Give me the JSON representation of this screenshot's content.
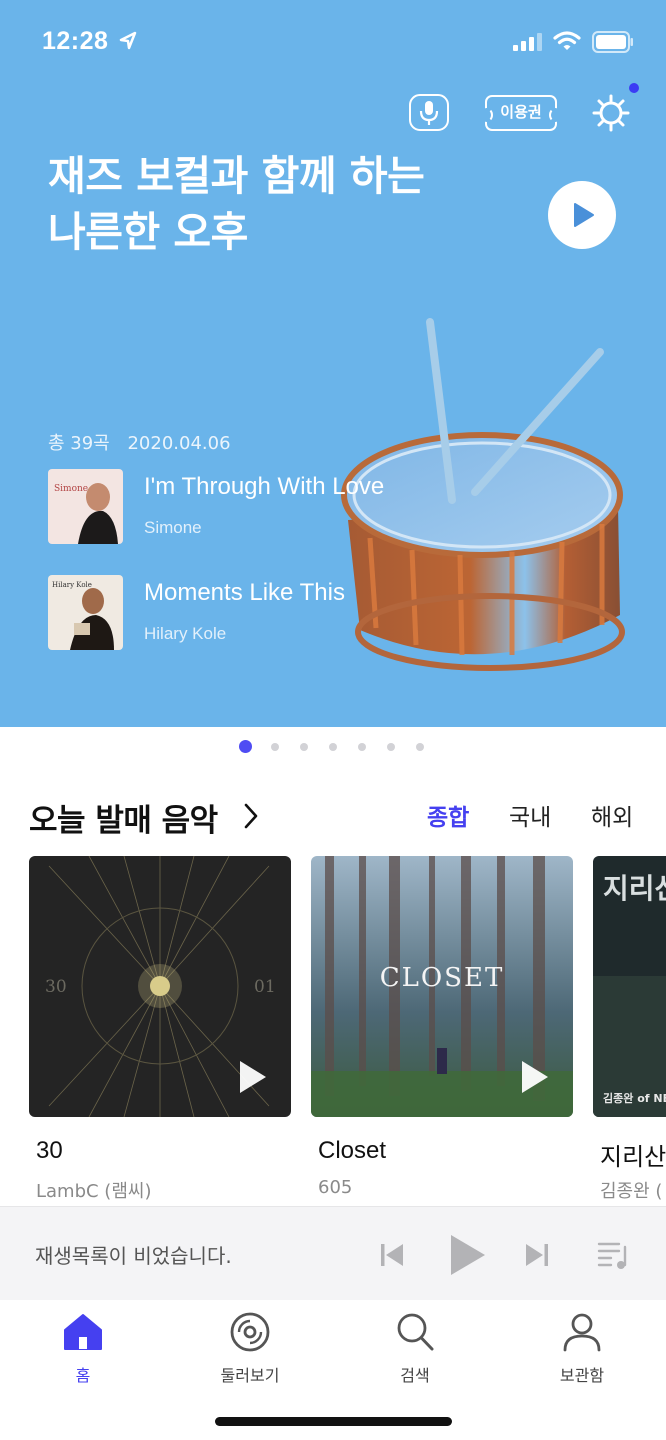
{
  "status_bar": {
    "time": "12:28"
  },
  "header": {
    "pass_label": "이용권"
  },
  "hero": {
    "title_line1": "재즈 보컬과 함께 하는",
    "title_line2": "나른한 오후",
    "track_count": "총 39곡",
    "date": "2020.04.06",
    "tracks": [
      {
        "title": "I'm Through With Love",
        "artist": "Simone",
        "cover_text": "Simone"
      },
      {
        "title": "Moments Like This",
        "artist": "Hilary Kole",
        "cover_text": "Hilary Kole"
      }
    ]
  },
  "carousel": {
    "page_count": 7,
    "active_index": 0
  },
  "new_releases": {
    "title": "오늘 발매 음악",
    "filters": [
      "종합",
      "국내",
      "해외"
    ],
    "active_filter": "종합",
    "albums": [
      {
        "title": "30",
        "artist": "LambC (램씨)",
        "cover_left": "30",
        "cover_right": "01"
      },
      {
        "title": "Closet",
        "artist": "605",
        "cover_text": "CLOSET"
      },
      {
        "title": "지리산",
        "artist": "김종완 (",
        "cover_text": "지리산",
        "cover_sub": "김종완 of NE"
      }
    ]
  },
  "mini_player": {
    "empty_text": "재생목록이 비었습니다."
  },
  "tab_bar": {
    "tabs": [
      {
        "label": "홈",
        "icon": "home-icon",
        "active": true
      },
      {
        "label": "둘러보기",
        "icon": "disc-icon",
        "active": false
      },
      {
        "label": "검색",
        "icon": "search-icon",
        "active": false
      },
      {
        "label": "보관함",
        "icon": "person-icon",
        "active": false
      }
    ]
  },
  "colors": {
    "hero_bg": "#6ab4ea",
    "accent": "#4540f0",
    "mini_player_bg": "#f4f4f6"
  }
}
